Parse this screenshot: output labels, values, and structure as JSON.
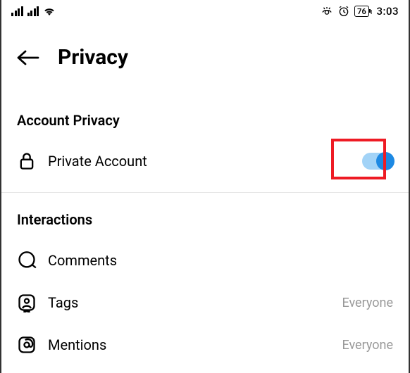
{
  "statusBar": {
    "battery": "76",
    "time": "3:03"
  },
  "header": {
    "title": "Privacy"
  },
  "sections": {
    "accountPrivacy": {
      "title": "Account Privacy",
      "privateAccount": {
        "label": "Private Account",
        "toggleOn": true
      }
    },
    "interactions": {
      "title": "Interactions",
      "comments": {
        "label": "Comments"
      },
      "tags": {
        "label": "Tags",
        "value": "Everyone"
      },
      "mentions": {
        "label": "Mentions",
        "value": "Everyone"
      }
    }
  }
}
